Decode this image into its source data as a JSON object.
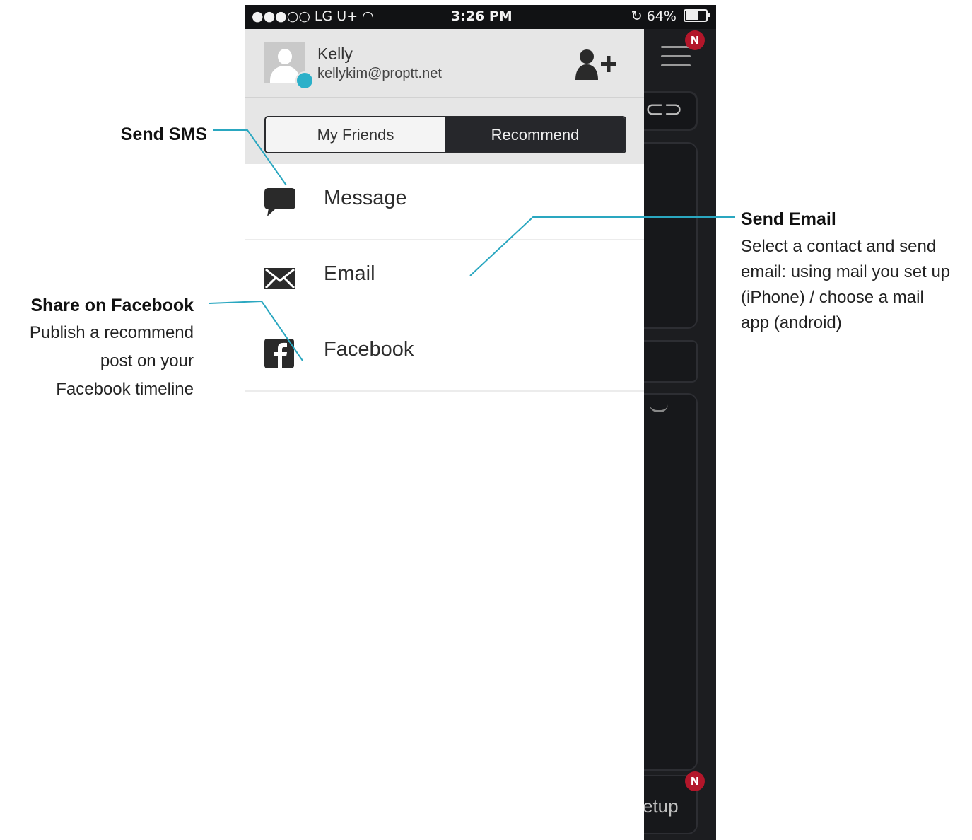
{
  "status_bar": {
    "carrier": "●●●○○ LG U+",
    "wifi_icon": "wifi-icon",
    "time": "3:26 PM",
    "battery": "64%"
  },
  "profile": {
    "name": "Kelly",
    "email": "kellykim@proptt.net",
    "online_color": "#2bb0c9"
  },
  "tabs": [
    {
      "label": "My Friends",
      "active": false
    },
    {
      "label": "Recommend",
      "active": true
    }
  ],
  "menu": [
    {
      "label": "Message",
      "icon": "speech-bubble-icon"
    },
    {
      "label": "Email",
      "icon": "envelope-icon"
    },
    {
      "label": "Facebook",
      "icon": "facebook-icon"
    }
  ],
  "background_app": {
    "badge_top": "N",
    "badge_bottom": "N",
    "setup_partial": "etup"
  },
  "annotations": {
    "sms": {
      "title": "Send SMS"
    },
    "email": {
      "title": "Send Email",
      "desc_lines": [
        "Select a contact and send",
        "email: using mail you set up",
        "(iPhone) / choose a mail",
        "app (android)"
      ]
    },
    "facebook": {
      "title": "Share on Facebook",
      "desc_lines": [
        "Publish a recommend",
        "post on your",
        "Facebook timeline"
      ]
    }
  },
  "colors": {
    "accent_line": "#2aa7c0",
    "badge": "#b3162a",
    "dark_bg": "#1c1d20"
  }
}
